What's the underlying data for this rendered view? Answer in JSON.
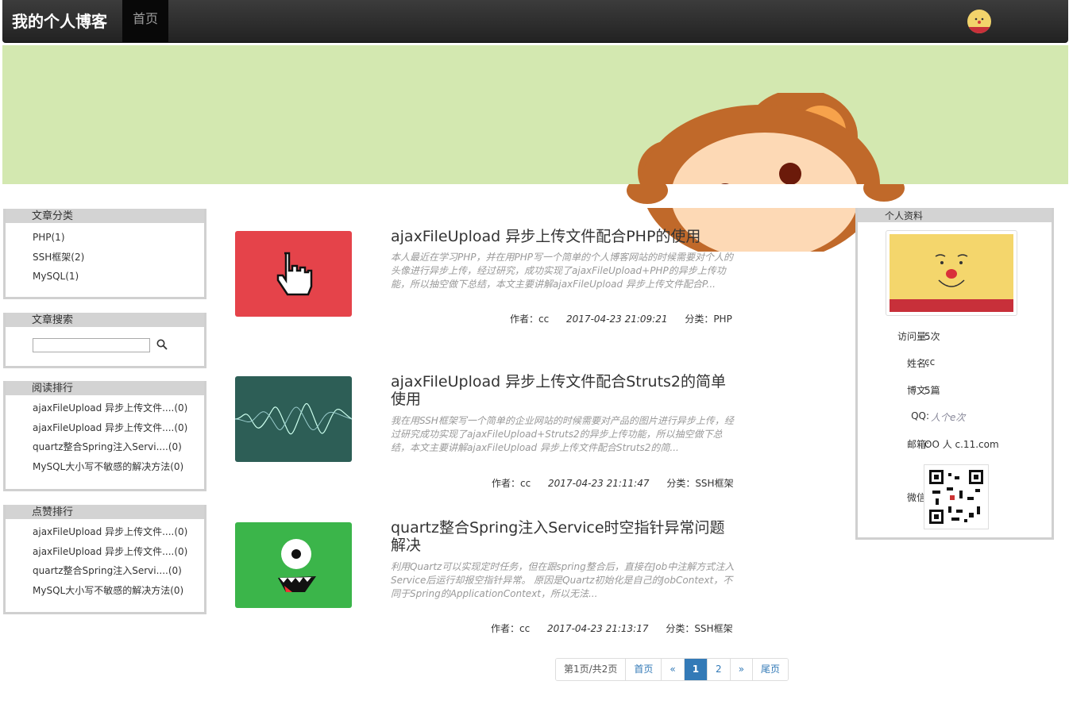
{
  "nav": {
    "brand": "我的个人博客",
    "home": "首页"
  },
  "categories": {
    "title": "文章分类",
    "items": [
      "PHP(1)",
      "SSH框架(2)",
      "MySQL(1)"
    ]
  },
  "search": {
    "title": "文章搜索",
    "placeholder": ""
  },
  "read_rank": {
    "title": "阅读排行",
    "items": [
      "ajaxFileUpload 异步上传文件....(0)",
      "ajaxFileUpload 异步上传文件....(0)",
      "quartz整合Spring注入Servi....(0)",
      "MySQL大小写不敏感的解决方法(0)"
    ]
  },
  "like_rank": {
    "title": "点赞排行",
    "items": [
      "ajaxFileUpload 异步上传文件....(0)",
      "ajaxFileUpload 异步上传文件....(0)",
      "quartz整合Spring注入Servi....(0)",
      "MySQL大小写不敏感的解决方法(0)"
    ]
  },
  "articles": [
    {
      "title": "ajaxFileUpload 异步上传文件配合PHP的使用",
      "summary": "本人最近在学习PHP，并在用PHP写一个简单的个人博客网站的时候需要对个人的头像进行异步上传，经过研究，成功实现了ajaxFileUpload+PHP的异步上传功能，所以抽空做下总结，本文主要讲解ajaxFileUpload 异步上传文件配合P...",
      "author": "作者：cc",
      "date": "2017-04-23 21:09:21",
      "category": "分类：PHP",
      "thumb_color": "#e5434a"
    },
    {
      "title": "ajaxFileUpload 异步上传文件配合Struts2的简单使用",
      "summary": "我在用SSH框架写一个简单的企业网站的时候需要对产品的图片进行异步上传，经过研究成功实现了ajaxFileUpload+Struts2的异步上传功能，所以抽空做下总结，本文主要讲解ajaxFileUpload 异步上传文件配合Struts2的简...",
      "author": "作者：cc",
      "date": "2017-04-23 21:11:47",
      "category": "分类：SSH框架",
      "thumb_color": "#2d5e56"
    },
    {
      "title": "quartz整合Spring注入Service时空指针异常问题解决",
      "summary": "利用Quartz可以实现定时任务，但在跟spring整合后，直接在Job中注解方式注入Service后运行却报空指针异常。 原因是Quartz初始化是自己的JobContext，不同于Spring的ApplicationContext，所以无法...",
      "author": "作者：cc",
      "date": "2017-04-23 21:13:17",
      "category": "分类：SSH框架",
      "thumb_color": "#3bb54a"
    }
  ],
  "pager": {
    "info": "第1页/共2页",
    "first": "首页",
    "prev": "«",
    "p1": "1",
    "p2": "2",
    "next": "»",
    "last": "尾页"
  },
  "profile": {
    "title": "个人资料",
    "visits_label": "访问量:",
    "visits": "5次",
    "name_label": "姓名:",
    "name": "cc",
    "posts_label": "博文:",
    "posts": "5篇",
    "qq_label": "QQ:",
    "qq": "人个e次",
    "email_label": "邮箱:",
    "email": "OO     人 c.11.com",
    "wechat_label": "微信:"
  }
}
